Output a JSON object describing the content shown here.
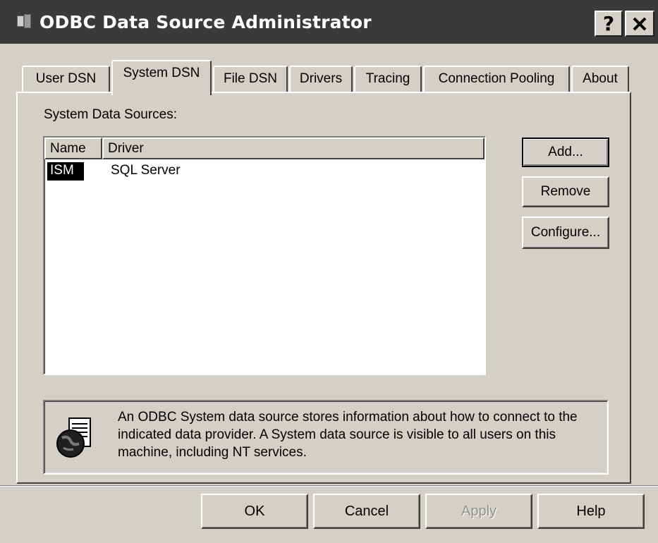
{
  "window": {
    "title": "ODBC Data Source Administrator",
    "help_button": "?",
    "close_button": "✕"
  },
  "tabs": [
    {
      "label": "User DSN",
      "active": false
    },
    {
      "label": "System DSN",
      "active": true
    },
    {
      "label": "File DSN",
      "active": false
    },
    {
      "label": "Drivers",
      "active": false
    },
    {
      "label": "Tracing",
      "active": false
    },
    {
      "label": "Connection Pooling",
      "active": false
    },
    {
      "label": "About",
      "active": false
    }
  ],
  "panel": {
    "section_label": "System Data Sources:",
    "list": {
      "columns": [
        "Name",
        "Driver"
      ],
      "rows": [
        {
          "name": "ISM",
          "driver": "SQL Server",
          "selected": true
        }
      ]
    },
    "buttons": {
      "add": "Add...",
      "remove": "Remove",
      "configure": "Configure..."
    },
    "info_text": "An ODBC System data source stores information about how to connect to the indicated data provider.  A System data source is visible to all users on this machine, including NT services."
  },
  "footer": {
    "ok": "OK",
    "cancel": "Cancel",
    "apply": "Apply",
    "help": "Help"
  },
  "colors": {
    "face": "#d4d0c8",
    "titlebar": "#3a3a3a",
    "selection": "#000000"
  }
}
